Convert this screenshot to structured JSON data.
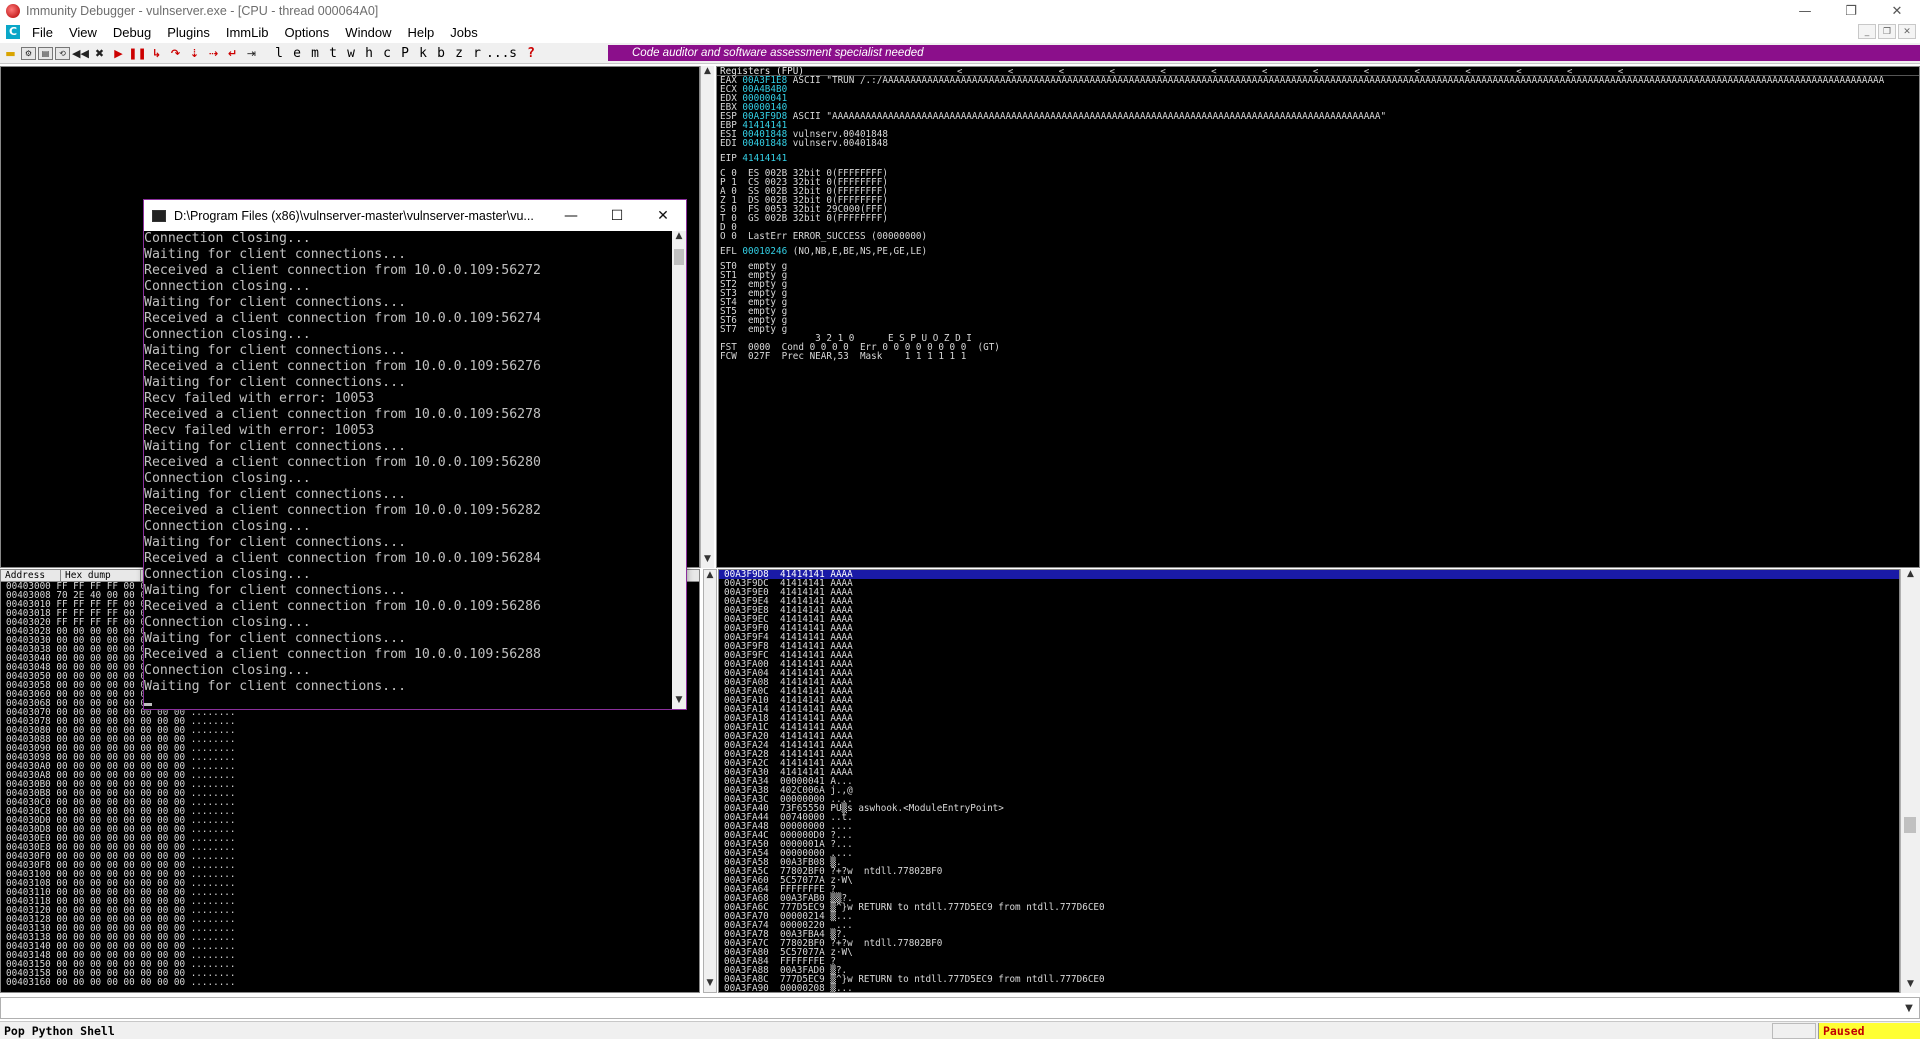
{
  "window": {
    "title": "Immunity Debugger - vulnserver.exe - [CPU - thread 000064A0]",
    "controls": [
      "—",
      "❐",
      "✕"
    ]
  },
  "menu": {
    "items": [
      "File",
      "View",
      "Debug",
      "Plugins",
      "ImmLib",
      "Options",
      "Window",
      "Help",
      "Jobs"
    ]
  },
  "toolbar": {
    "letters": [
      "l",
      "e",
      "m",
      "t",
      "w",
      "h",
      "c",
      "P",
      "k",
      "b",
      "z",
      "r",
      "...",
      "s",
      "?"
    ],
    "banner": "Code auditor and software assessment specialist needed"
  },
  "registers": {
    "header": "Registers (FPU)",
    "arrows": "< < < < < < < < < < < < < <",
    "lines": [
      {
        "name": "EAX",
        "value": "00A3F1E8",
        "note": "ASCII \"TRUN /.:/AAAAAAAAAAAAAAAAAAAAAAAAAAAAAAAAAAAAAAAAAAAAAAAAAAAAAAAAAAAAAAAAAAAAAAAAAAAAAAAAAAAAAAAAAAAAAAAAAAAAAAAAAAAAAAAAAAAAAAAAAAAAAAAAAAAAAAAAAAAAAAAAAAAAAAAAAAAAAAAAAAAAAAAAAAAAAAAAAAA"
      },
      {
        "name": "ECX",
        "value": "00A4B4B0",
        "note": ""
      },
      {
        "name": "EDX",
        "value": "00000041",
        "note": ""
      },
      {
        "name": "EBX",
        "value": "00000140",
        "note": ""
      },
      {
        "name": "ESP",
        "value": "00A3F9D8",
        "note": "ASCII \"AAAAAAAAAAAAAAAAAAAAAAAAAAAAAAAAAAAAAAAAAAAAAAAAAAAAAAAAAAAAAAAAAAAAAAAAAAAAAAAAAAAAAAAAAAAAAAAAAA\""
      },
      {
        "name": "EBP",
        "value": "41414141",
        "note": ""
      },
      {
        "name": "ESI",
        "value": "00401848",
        "note": "vulnserv.00401848"
      },
      {
        "name": "EDI",
        "value": "00401848",
        "note": "vulnserv.00401848"
      },
      {
        "name": "",
        "value": "",
        "note": ""
      },
      {
        "name": "EIP",
        "value": "41414141",
        "note": ""
      },
      {
        "name": "",
        "value": "",
        "note": ""
      },
      {
        "name": "C 0",
        "value": "",
        "note": "ES 002B 32bit 0(FFFFFFFF)"
      },
      {
        "name": "P 1",
        "value": "",
        "note": "CS 0023 32bit 0(FFFFFFFF)"
      },
      {
        "name": "A 0",
        "value": "",
        "note": "SS 002B 32bit 0(FFFFFFFF)"
      },
      {
        "name": "Z 1",
        "value": "",
        "note": "DS 002B 32bit 0(FFFFFFFF)"
      },
      {
        "name": "S 0",
        "value": "",
        "note": "FS 0053 32bit 29C000(FFF)"
      },
      {
        "name": "T 0",
        "value": "",
        "note": "GS 002B 32bit 0(FFFFFFFF)"
      },
      {
        "name": "D 0",
        "value": "",
        "note": ""
      },
      {
        "name": "O 0",
        "value": "",
        "note": "LastErr ERROR_SUCCESS (00000000)"
      },
      {
        "name": "",
        "value": "",
        "note": ""
      },
      {
        "name": "EFL",
        "value": "00010246",
        "note": "(NO,NB,E,BE,NS,PE,GE,LE)"
      },
      {
        "name": "",
        "value": "",
        "note": ""
      },
      {
        "name": "ST0",
        "value": "",
        "note": "empty g"
      },
      {
        "name": "ST1",
        "value": "",
        "note": "empty g"
      },
      {
        "name": "ST2",
        "value": "",
        "note": "empty g"
      },
      {
        "name": "ST3",
        "value": "",
        "note": "empty g"
      },
      {
        "name": "ST4",
        "value": "",
        "note": "empty g"
      },
      {
        "name": "ST5",
        "value": "",
        "note": "empty g"
      },
      {
        "name": "ST6",
        "value": "",
        "note": "empty g"
      },
      {
        "name": "ST7",
        "value": "",
        "note": "empty g"
      },
      {
        "name": "",
        "value": "",
        "note": "               3 2 1 0      E S P U O Z D I"
      },
      {
        "name": "FST",
        "value": "",
        "note": "0000  Cond 0 0 0 0  Err 0 0 0 0 0 0 0 0  (GT)"
      },
      {
        "name": "FCW",
        "value": "",
        "note": "027F  Prec NEAR,53  Mask    1 1 1 1 1 1"
      }
    ]
  },
  "dump": {
    "headers": [
      "Address",
      "Hex dump"
    ],
    "rows": [
      "00403000 FF FF FF FF 00 00 00 00 ....",
      "00403008 70 2E 40 00 00 00 00 00 p.@.....",
      "00403010 FF FF FF FF 00 00 00 00 ....",
      "00403018 FF FF FF FF 00 00 00 00 ....",
      "00403020 FF FF FF FF 00 00 00 00 ....",
      "00403028 00 00 00 00 00 00 00 00 ........",
      "00403030 00 00 00 00 00 00 00 00 ........",
      "00403038 00 00 00 00 00 00 00 00 ........",
      "00403040 00 00 00 00 00 00 00 00 ........",
      "00403048 00 00 00 00 00 00 00 00 ........",
      "00403050 00 00 00 00 00 00 00 00 ........",
      "00403058 00 00 00 00 00 00 00 00 ........",
      "00403060 00 00 00 00 00 00 00 00 ........",
      "00403068 00 00 00 00 00 00 00 00 ........",
      "00403070 00 00 00 00 00 00 00 00 ........",
      "00403078 00 00 00 00 00 00 00 00 ........",
      "00403080 00 00 00 00 00 00 00 00 ........",
      "00403088 00 00 00 00 00 00 00 00 ........",
      "00403090 00 00 00 00 00 00 00 00 ........",
      "00403098 00 00 00 00 00 00 00 00 ........",
      "004030A0 00 00 00 00 00 00 00 00 ........",
      "004030A8 00 00 00 00 00 00 00 00 ........",
      "004030B0 00 00 00 00 00 00 00 00 ........",
      "004030B8 00 00 00 00 00 00 00 00 ........",
      "004030C0 00 00 00 00 00 00 00 00 ........",
      "004030C8 00 00 00 00 00 00 00 00 ........",
      "004030D0 00 00 00 00 00 00 00 00 ........",
      "004030D8 00 00 00 00 00 00 00 00 ........",
      "004030E0 00 00 00 00 00 00 00 00 ........",
      "004030E8 00 00 00 00 00 00 00 00 ........",
      "004030F0 00 00 00 00 00 00 00 00 ........",
      "004030F8 00 00 00 00 00 00 00 00 ........",
      "00403100 00 00 00 00 00 00 00 00 ........",
      "00403108 00 00 00 00 00 00 00 00 ........",
      "00403110 00 00 00 00 00 00 00 00 ........",
      "00403118 00 00 00 00 00 00 00 00 ........",
      "00403120 00 00 00 00 00 00 00 00 ........",
      "00403128 00 00 00 00 00 00 00 00 ........",
      "00403130 00 00 00 00 00 00 00 00 ........",
      "00403138 00 00 00 00 00 00 00 00 ........",
      "00403140 00 00 00 00 00 00 00 00 ........",
      "00403148 00 00 00 00 00 00 00 00 ........",
      "00403150 00 00 00 00 00 00 00 00 ........",
      "00403158 00 00 00 00 00 00 00 00 ........",
      "00403160 00 00 00 00 00 00 00 00 ........"
    ]
  },
  "stack": {
    "rows": [
      "00A3F9D8  41414141 AAAA",
      "00A3F9DC  41414141 AAAA",
      "00A3F9E0  41414141 AAAA",
      "00A3F9E4  41414141 AAAA",
      "00A3F9E8  41414141 AAAA",
      "00A3F9EC  41414141 AAAA",
      "00A3F9F0  41414141 AAAA",
      "00A3F9F4  41414141 AAAA",
      "00A3F9F8  41414141 AAAA",
      "00A3F9FC  41414141 AAAA",
      "00A3FA00  41414141 AAAA",
      "00A3FA04  41414141 AAAA",
      "00A3FA08  41414141 AAAA",
      "00A3FA0C  41414141 AAAA",
      "00A3FA10  41414141 AAAA",
      "00A3FA14  41414141 AAAA",
      "00A3FA18  41414141 AAAA",
      "00A3FA1C  41414141 AAAA",
      "00A3FA20  41414141 AAAA",
      "00A3FA24  41414141 AAAA",
      "00A3FA28  41414141 AAAA",
      "00A3FA2C  41414141 AAAA",
      "00A3FA30  41414141 AAAA",
      "00A3FA34  00000041 A...",
      "00A3FA38  402C006A j.,@",
      "00A3FA3C  00000000 ....",
      "00A3FA40  73F65550 PU▒s aswhook.<ModuleEntryPoint>",
      "00A3FA44  00740000 ..t.",
      "00A3FA48  00000000 ....",
      "00A3FA4C  000000D0 ?...",
      "00A3FA50  0000001A ?...",
      "00A3FA54  00000000 ....",
      "00A3FA58  00A3FB08 ▒.",
      "00A3FA5C  77802BF0 ?+?w  ntdll.77802BF0",
      "00A3FA60  5C57077A z·W\\",
      "00A3FA64  FFFFFFFE ?",
      "00A3FA68  00A3FAB0 ▒▒?.",
      "00A3FA6C  777D5EC9 ▒^}w RETURN to ntdll.777D5EC9 from ntdll.777D6CE0",
      "00A3FA70  00000214 ▒...",
      "00A3FA74  00000220  ...",
      "00A3FA78  00A3FBA4 ▒?.",
      "00A3FA7C  77802BF0 ?+?w  ntdll.77802BF0",
      "00A3FA80  5C57077A z·W\\",
      "00A3FA84  FFFFFFFE ?",
      "00A3FA88  00A3FAD0 ▒?.",
      "00A3FA8C  777D5EC9 ▒^}w RETURN to ntdll.777D5EC9 from ntdll.777D6CE0",
      "00A3FA90  00000208 ▒..."
    ]
  },
  "console": {
    "title": "D:\\Program Files (x86)\\vulnserver-master\\vulnserver-master\\vu...",
    "lines": [
      "Connection closing...",
      "Waiting for client connections...",
      "Received a client connection from 10.0.0.109:56272",
      "Connection closing...",
      "Waiting for client connections...",
      "Received a client connection from 10.0.0.109:56274",
      "Connection closing...",
      "Waiting for client connections...",
      "Received a client connection from 10.0.0.109:56276",
      "Waiting for client connections...",
      "Recv failed with error: 10053",
      "Received a client connection from 10.0.0.109:56278",
      "Recv failed with error: 10053",
      "Waiting for client connections...",
      "Received a client connection from 10.0.0.109:56280",
      "Connection closing...",
      "Waiting for client connections...",
      "Received a client connection from 10.0.0.109:56282",
      "Connection closing...",
      "Waiting for client connections...",
      "Received a client connection from 10.0.0.109:56284",
      "Connection closing...",
      "Waiting for client connections...",
      "Received a client connection from 10.0.0.109:56286",
      "Connection closing...",
      "Waiting for client connections...",
      "Received a client connection from 10.0.0.109:56288",
      "Connection closing...",
      "Waiting for client connections..."
    ]
  },
  "status": {
    "text": "Pop Python Shell",
    "state": "Paused"
  },
  "colors": {
    "banner": "#8b0f8b",
    "register_value": "#33d0e6",
    "status_state_bg": "#ffff33",
    "status_state_fg": "#c00000",
    "stack_selected": "#1a1aa6"
  }
}
